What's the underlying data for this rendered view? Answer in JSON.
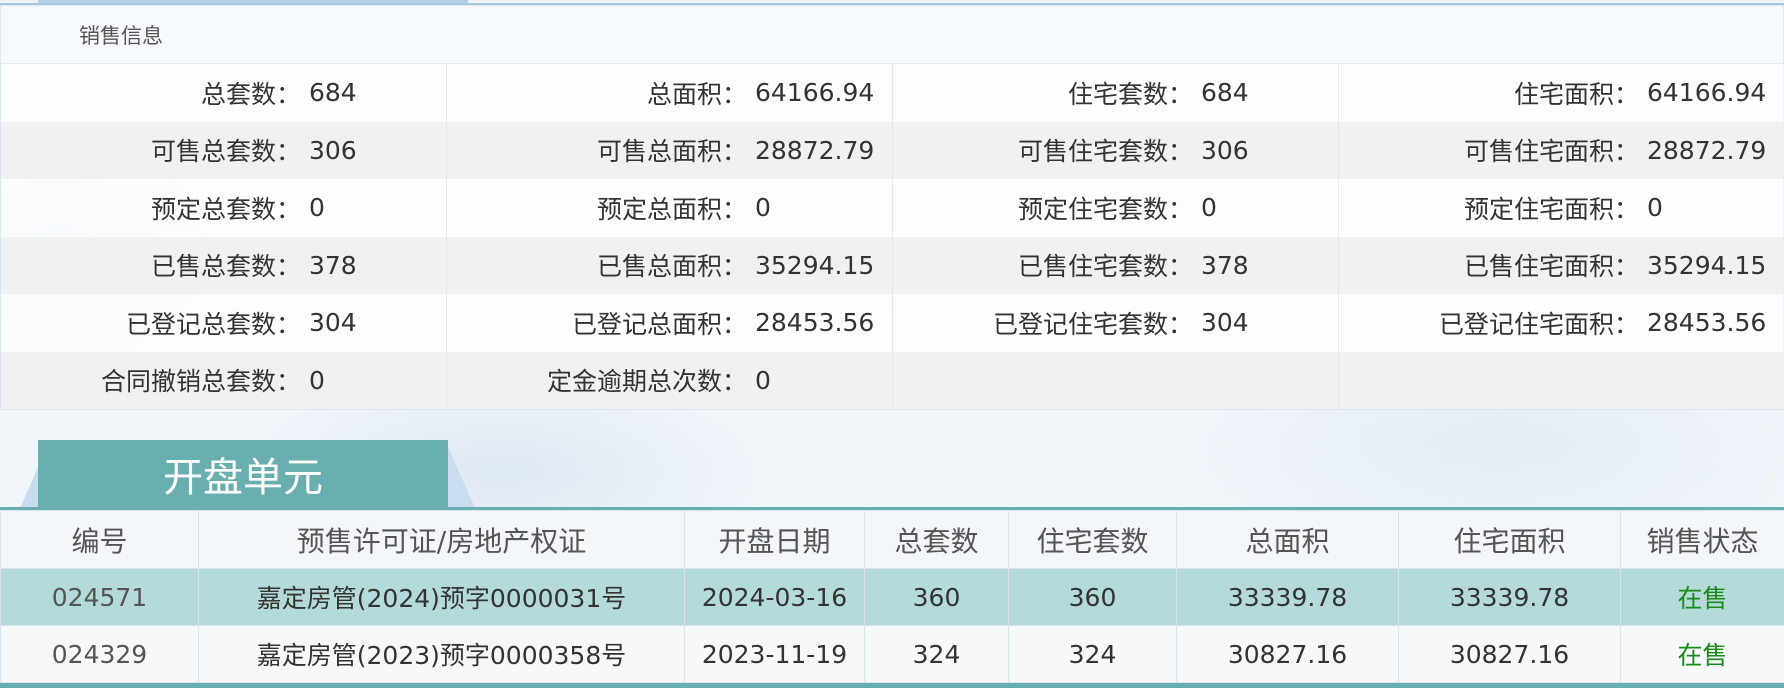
{
  "sales_info": {
    "title": "销售信息",
    "rows": [
      [
        {
          "label": "总套数：",
          "value": "684"
        },
        {
          "label": "总面积：",
          "value": "64166.94"
        },
        {
          "label": "住宅套数：",
          "value": "684"
        },
        {
          "label": "住宅面积：",
          "value": "64166.94"
        }
      ],
      [
        {
          "label": "可售总套数：",
          "value": "306"
        },
        {
          "label": "可售总面积：",
          "value": "28872.79"
        },
        {
          "label": "可售住宅套数：",
          "value": "306"
        },
        {
          "label": "可售住宅面积：",
          "value": "28872.79"
        }
      ],
      [
        {
          "label": "预定总套数：",
          "value": "0"
        },
        {
          "label": "预定总面积：",
          "value": "0"
        },
        {
          "label": "预定住宅套数：",
          "value": "0"
        },
        {
          "label": "预定住宅面积：",
          "value": "0"
        }
      ],
      [
        {
          "label": "已售总套数：",
          "value": "378"
        },
        {
          "label": "已售总面积：",
          "value": "35294.15"
        },
        {
          "label": "已售住宅套数：",
          "value": "378"
        },
        {
          "label": "已售住宅面积：",
          "value": "35294.15"
        }
      ],
      [
        {
          "label": "已登记总套数：",
          "value": "304"
        },
        {
          "label": "已登记总面积：",
          "value": "28453.56"
        },
        {
          "label": "已登记住宅套数：",
          "value": "304"
        },
        {
          "label": "已登记住宅面积：",
          "value": "28453.56"
        }
      ],
      [
        {
          "label": "合同撤销总套数：",
          "value": "0"
        },
        {
          "label": "定金逾期总次数：",
          "value": "0"
        },
        {
          "label": "",
          "value": ""
        },
        {
          "label": "",
          "value": ""
        }
      ]
    ]
  },
  "open_units": {
    "tab_label": "开盘单元",
    "columns": [
      "编号",
      "预售许可证/房地产权证",
      "开盘日期",
      "总套数",
      "住宅套数",
      "总面积",
      "住宅面积",
      "销售状态"
    ],
    "rows": [
      [
        "024571",
        "嘉定房管(2024)预字0000031号",
        "2024-03-16",
        "360",
        "360",
        "33339.78",
        "33339.78",
        "在售"
      ],
      [
        "024329",
        "嘉定房管(2023)预字0000358号",
        "2023-11-19",
        "324",
        "324",
        "30827.16",
        "30827.16",
        "在售"
      ]
    ]
  },
  "colors": {
    "accent_teal": "#6aafb0",
    "selected_row": "#b5dada",
    "status_green": "#1a8a1a"
  }
}
